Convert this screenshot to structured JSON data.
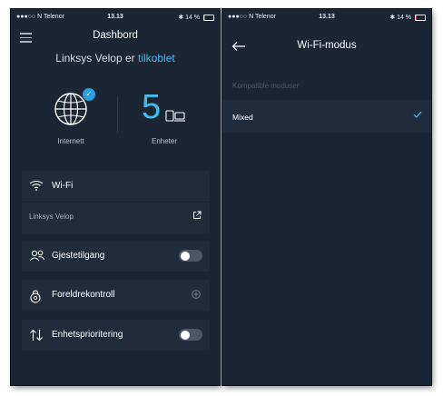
{
  "status_bar": {
    "carrier": "●●●○○ N Telenor",
    "time": "13.13",
    "battery": "14 %",
    "battery_level": 0.14
  },
  "dashboard": {
    "title": "Dashbord",
    "tagline_prefix": "Linksys Velop er",
    "tagline_status": "tilkoblet",
    "internet_label": "Internett",
    "device_count": "5",
    "devices_label": "Enheter",
    "wifi": {
      "label": "Wi-Fi",
      "network_name": "Linksys Velop"
    },
    "guest_access": {
      "label": "Gjestetilgang",
      "enabled": false
    },
    "parental_controls": {
      "label": "Foreldrekontroll"
    },
    "device_prioritization": {
      "label": "Enhetsprioritering",
      "enabled": false
    }
  },
  "wifi_mode": {
    "title": "Wi-Fi-modus",
    "section_label": "Kompatible moduser",
    "options": [
      {
        "label": "Mixed",
        "selected": true
      }
    ]
  },
  "colors": {
    "background": "#1b2533",
    "card": "#202c3c",
    "accent": "#3ebef0",
    "check": "#27a0e2"
  }
}
